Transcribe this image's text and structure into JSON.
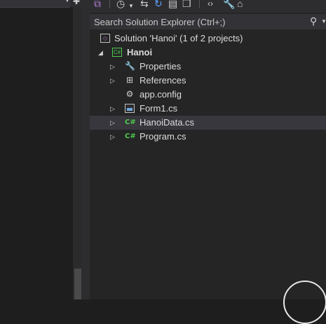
{
  "search": {
    "placeholder": "Search Solution Explorer (Ctrl+;)"
  },
  "solution": {
    "label": "Solution 'Hanoi' (1 of 2 projects)"
  },
  "project": {
    "label": "Hanoi"
  },
  "items": [
    {
      "label": "Properties"
    },
    {
      "label": "References"
    },
    {
      "label": "app.config"
    },
    {
      "label": "Form1.cs"
    },
    {
      "label": "HanoiData.cs"
    },
    {
      "label": "Program.cs"
    }
  ],
  "icons": {
    "cs": "C#",
    "project": "C#"
  },
  "colors": {
    "background": "#1e1e1e",
    "panel": "#252526",
    "selected_row": "#37373d",
    "csharp_green": "#4ec94e"
  }
}
